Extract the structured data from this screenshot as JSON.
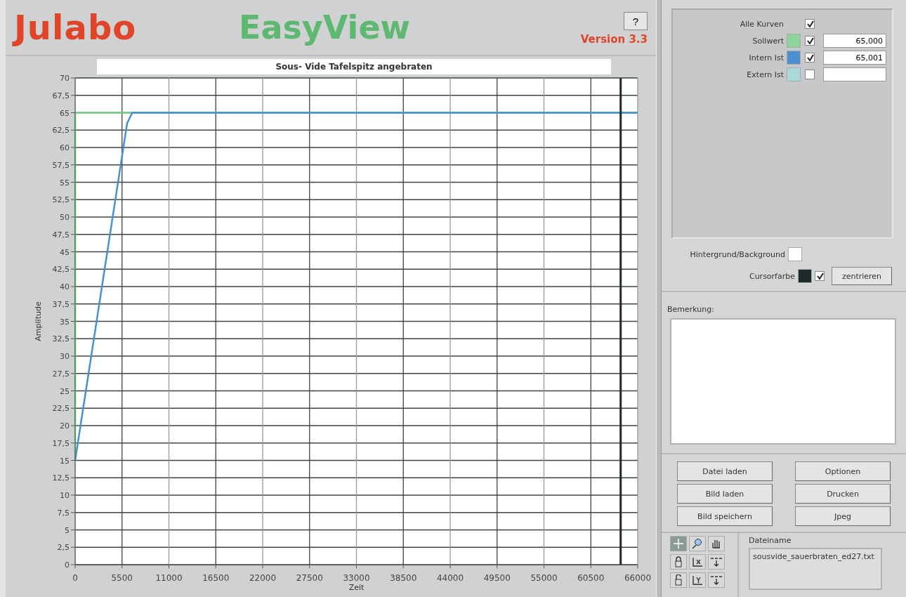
{
  "header": {
    "logo": "Julabo",
    "app_name": "EasyView",
    "help_button": "?",
    "version": "Version 3.3"
  },
  "chart_panel": {
    "chart_data": {
      "type": "line",
      "title": "Sous- Vide Tafelspitz angebraten",
      "xlabel": "Zeit",
      "ylabel": "Amplitude",
      "x": [
        0,
        0,
        6100,
        6700,
        66000
      ],
      "series": [
        {
          "color": "#74cc86",
          "values": [
            15,
            65,
            65,
            65,
            65
          ]
        },
        {
          "color": "#4a90d0",
          "values": [
            15,
            15,
            63.5,
            65,
            65
          ]
        }
      ],
      "grid": true,
      "xlim": [
        0,
        66000
      ],
      "ylim": [
        0,
        70
      ],
      "xticks": [
        0,
        5500,
        11000,
        16500,
        22000,
        27500,
        33000,
        38500,
        44000,
        49500,
        55000,
        60500,
        66000
      ],
      "yticks": [
        0,
        {
          "value": 2.5,
          "label": "2,5"
        },
        5,
        {
          "value": 7.5,
          "label": "7,5"
        },
        10,
        {
          "value": 12.5,
          "label": "12,5"
        },
        15,
        {
          "value": 17.5,
          "label": "17,5"
        },
        20,
        {
          "value": 22.5,
          "label": "22,5"
        },
        25,
        {
          "value": 27.5,
          "label": "27,5"
        },
        30,
        {
          "value": 32.5,
          "label": "32,5"
        },
        35,
        {
          "value": 37.5,
          "label": "37,5"
        },
        40,
        {
          "value": 42.5,
          "label": "42,5"
        },
        45,
        {
          "value": 47.5,
          "label": "47,5"
        },
        50,
        {
          "value": 52.5,
          "label": "52,5"
        },
        55,
        {
          "value": 57.5,
          "label": "57,5"
        },
        60,
        {
          "value": 62.5,
          "label": "62,5"
        },
        65,
        {
          "value": 67.5,
          "label": "67,5"
        },
        70
      ],
      "ref_lines": [
        {
          "axis": "x",
          "value": 64000
        }
      ]
    }
  },
  "legend": {
    "all_curves": {
      "label": "Alle Kurven",
      "checked": true
    },
    "curves": [
      {
        "label": "Sollwert",
        "color": "#8cd49a",
        "checked": true,
        "value": "65,000"
      },
      {
        "label": "Intern Ist",
        "color": "#4a90d0",
        "checked": true,
        "value": "65,001"
      },
      {
        "label": "Extern Ist",
        "color": "#a8dada",
        "checked": false
      }
    ]
  },
  "display": {
    "background": {
      "label": "Hintergrund/Background",
      "color": "#ffffff"
    },
    "cursor": {
      "label": "Cursorfarbe",
      "color": "#1e2a2a",
      "checked": true
    },
    "center_button": "zentrieren"
  },
  "remark": {
    "label": "Bemerkung:"
  },
  "buttons": [
    "Datei laden",
    "Optionen",
    "Bild laden",
    "Drucken",
    "Bild speichern",
    "Jpeg"
  ],
  "mode_tools": [
    {
      "kind": "crosshair",
      "selected": true
    },
    {
      "kind": "zoom",
      "selected": false
    },
    {
      "kind": "pan",
      "selected": false
    }
  ],
  "axis_tools": [
    {
      "kind": "lock"
    },
    {
      "kind": "x-scale"
    },
    {
      "kind": "format"
    },
    {
      "kind": "unlock"
    },
    {
      "kind": "y-scale"
    },
    {
      "kind": "format"
    }
  ],
  "file": {
    "label": "Dateiname",
    "value": "sousvide_sauerbraten_ed27.txt"
  }
}
